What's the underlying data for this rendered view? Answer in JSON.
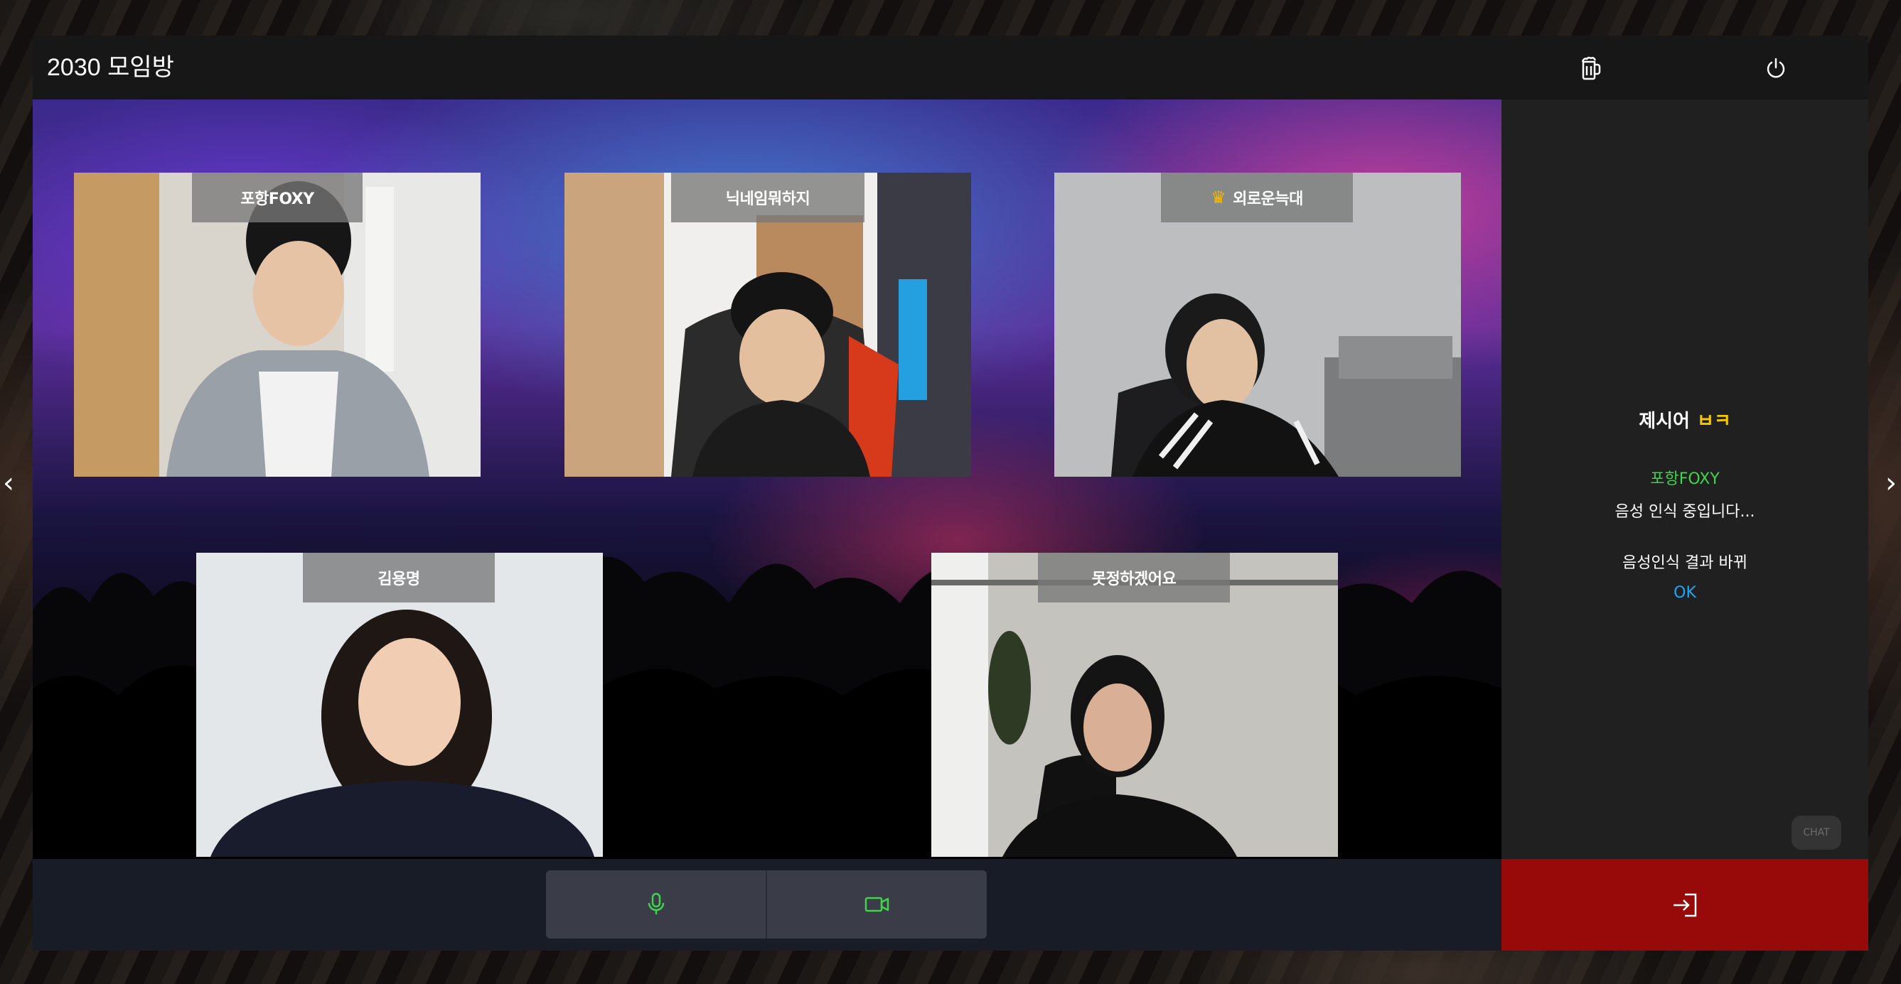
{
  "room": {
    "title": "2030 모임방"
  },
  "topbar": {
    "icons": [
      "beer-icon",
      "power-icon"
    ]
  },
  "participants": [
    {
      "name": "포항FOXY",
      "host": false
    },
    {
      "name": "닉네임뭐하지",
      "host": false
    },
    {
      "name": "외로운늑대",
      "host": true
    },
    {
      "name": "김용명",
      "host": false
    },
    {
      "name": "못정하겠어요",
      "host": false
    }
  ],
  "game_panel": {
    "presenter_label": "제시어",
    "hint": "ㅂㅋ",
    "speaker": "포항FOXY",
    "status": "음성 인식 중입니다...",
    "result_label": "음성인식 결과 바뀌",
    "result_value": "OK"
  },
  "chat_tab": {
    "label": "CHAT"
  },
  "controls": {
    "mic_icon": "microphone-icon",
    "camera_icon": "video-camera-icon",
    "exit_icon": "exit-icon"
  },
  "colors": {
    "speaker": "#3fd44a",
    "hint": "#f5c800",
    "ok": "#18a8ff",
    "exit_bg": "#980a0a",
    "control_icon": "#3fd44a",
    "crown": "#f5b800"
  }
}
